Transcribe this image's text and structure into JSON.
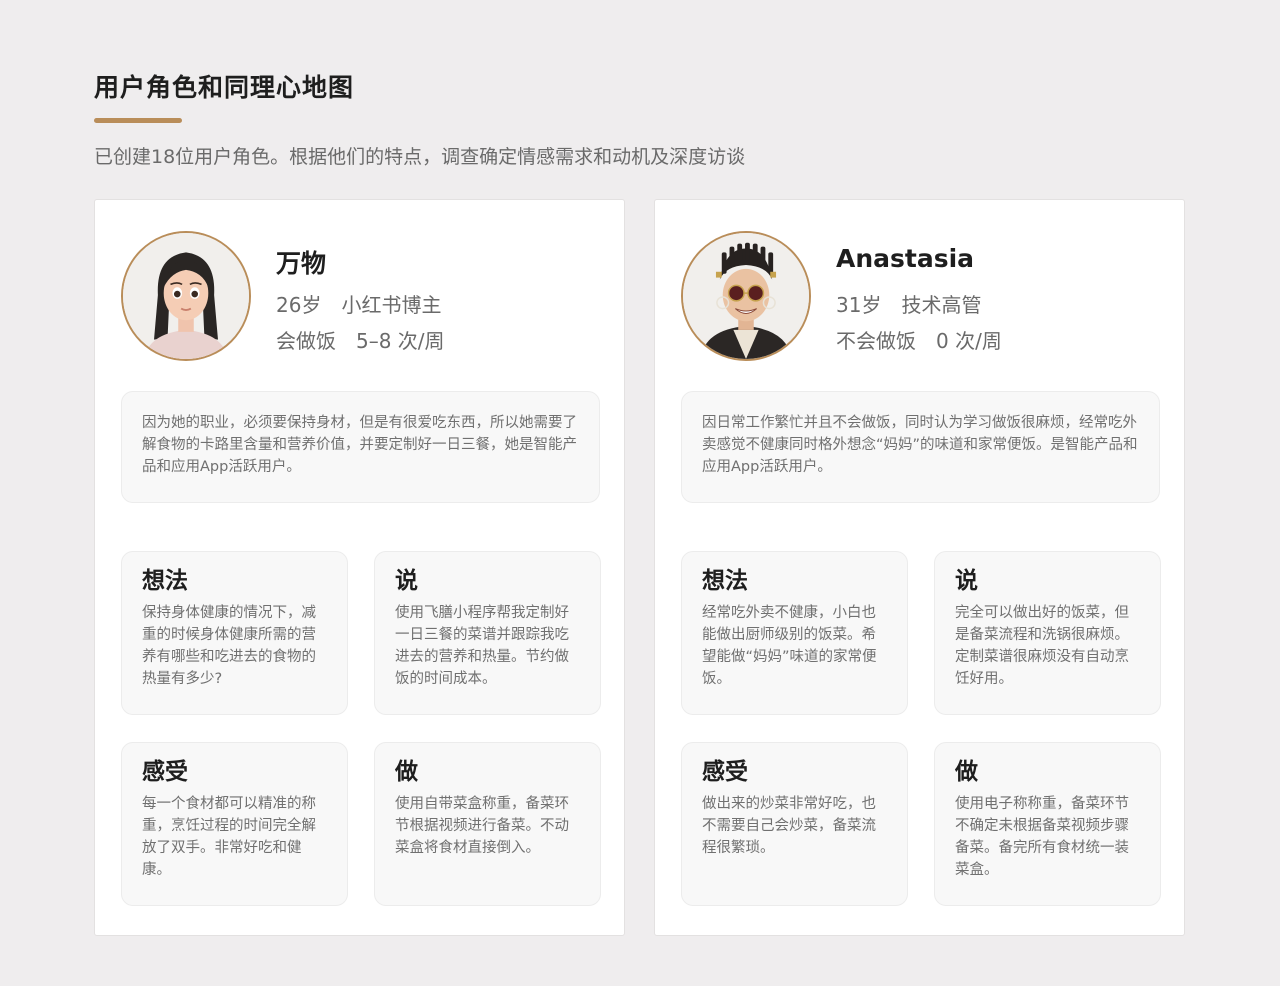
{
  "header": {
    "title": "用户角色和同理心地图",
    "subtitle": "已创建18位用户角色。根据他们的特点，调查确定情感需求和动机及深度访谈"
  },
  "colors": {
    "accent": "#b98d59",
    "background": "#efedee",
    "card": "#ffffff",
    "panel": "#f8f8f8"
  },
  "personas": [
    {
      "name": "万物",
      "age": "26岁",
      "role": "小红书博主",
      "cooking": "会做饭",
      "frequency": "5–8 次/周",
      "description": "因为她的职业，必须要保持身材，但是有很爱吃东西，所以她需要了解食物的卡路里含量和营养价值，并要定制好一日三餐，她是智能产品和应用App活跃用户。",
      "think": {
        "title": "想法",
        "text": "保持身体健康的情况下，减重的时候身体健康所需的营养有哪些和吃进去的食物的热量有多少?"
      },
      "say": {
        "title": "说",
        "text": "使用飞膳小程序帮我定制好一日三餐的菜谱并跟踪我吃进去的营养和热量。节约做饭的时间成本。"
      },
      "feel": {
        "title": "感受",
        "text": "每一个食材都可以精准的称重，烹饪过程的时间完全解放了双手。非常好吃和健康。"
      },
      "do": {
        "title": "做",
        "text": "使用自带菜盒称重，备菜环节根据视频进行备菜。不动菜盒将食材直接倒入。"
      }
    },
    {
      "name": "Anastasia",
      "age": "31岁",
      "role": "技术高管",
      "cooking": "不会做饭",
      "frequency": "0 次/周",
      "description": "因日常工作繁忙并且不会做饭，同时认为学习做饭很麻烦，经常吃外卖感觉不健康同时格外想念“妈妈”的味道和家常便饭。是智能产品和应用App活跃用户。",
      "think": {
        "title": "想法",
        "text": "经常吃外卖不健康，小白也能做出厨师级别的饭菜。希望能做“妈妈”味道的家常便饭。"
      },
      "say": {
        "title": "说",
        "text": "完全可以做出好的饭菜，但是备菜流程和洗锅很麻烦。定制菜谱很麻烦没有自动烹饪好用。"
      },
      "feel": {
        "title": "感受",
        "text": "做出来的炒菜非常好吃，也不需要自己会炒菜，备菜流程很繁琐。"
      },
      "do": {
        "title": "做",
        "text": "使用电子称称重，备菜环节不确定未根据备菜视频步骤备菜。备完所有食材统一装菜盒。"
      }
    }
  ]
}
